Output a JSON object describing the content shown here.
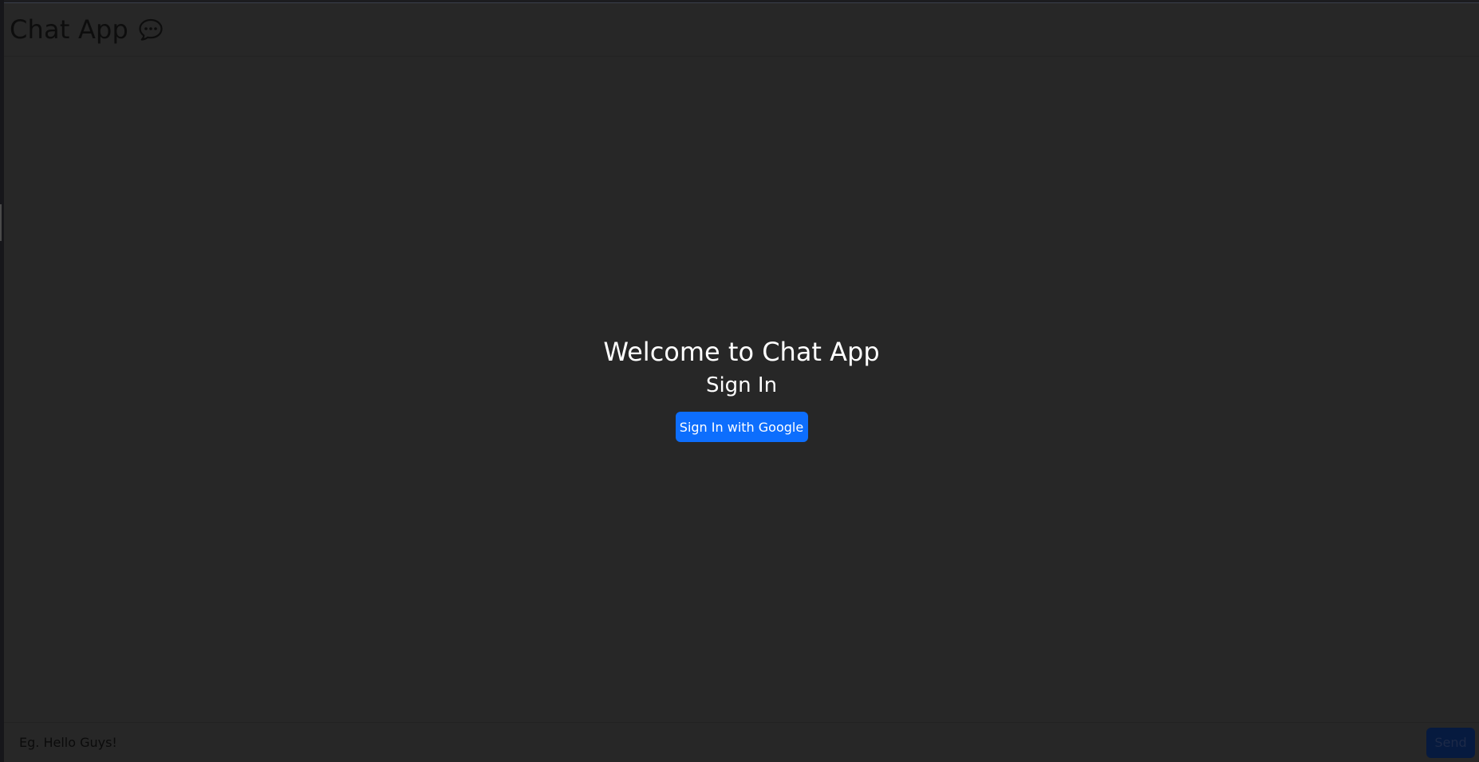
{
  "header": {
    "title": "Chat App",
    "icon": "speech-bubble-icon"
  },
  "auth": {
    "welcome_text": "Welcome to Chat App",
    "signin_heading": "Sign In",
    "google_button_label": "Sign In with Google"
  },
  "composer": {
    "input_value": "",
    "placeholder": "Eg. Hello Guys!",
    "send_label": "Send"
  },
  "colors": {
    "background": "#272727",
    "primary_button": "#0d6efd",
    "send_button_disabled": "#061a3f",
    "heading_text": "#ffffff"
  }
}
